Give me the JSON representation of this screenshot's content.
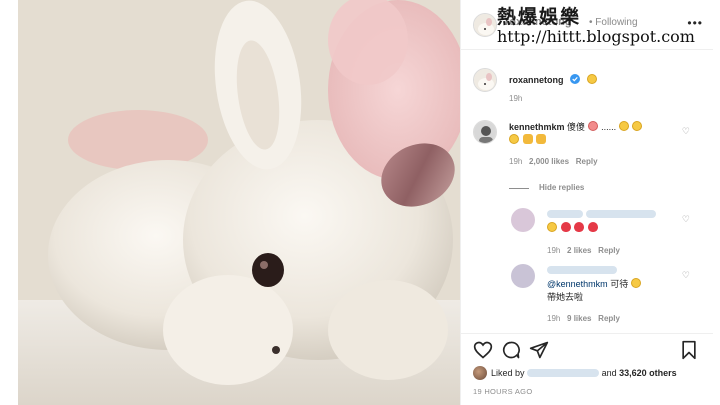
{
  "watermark": {
    "title": "熱爆娛樂",
    "url": "http://hittt.blogspot.com"
  },
  "post_header": {
    "username": "roxannetong",
    "follow_label": "• Following",
    "more_icon": "more-dots-icon"
  },
  "caption": {
    "username": "roxannetong",
    "verified_icon": "verified-badge-icon",
    "emoji_icon": "frowning-face-emoji",
    "age": "19h"
  },
  "comments": [
    {
      "username": "kennethmkm",
      "text": "傻傻",
      "ellipsis": "......",
      "age": "19h",
      "likes": "2,000 likes",
      "reply_label": "Reply",
      "hide_replies_label": "Hide replies"
    }
  ],
  "replies": [
    {
      "username": "kh████ @k████████",
      "age": "19h",
      "likes": "2 likes",
      "reply_label": "Reply"
    },
    {
      "mention": "@kennethmkm",
      "text_line1": "可待",
      "text_line2": "帶她去啦",
      "age": "19h",
      "likes": "9 likes",
      "reply_label": "Reply"
    }
  ],
  "footer": {
    "liked_by_prefix": "Liked by",
    "liked_by_suffix": "and",
    "others": "33,620 others",
    "time_ago": "19 HOURS AGO"
  },
  "colors": {
    "verified": "#3897f0",
    "heart_red": "#e53947",
    "muted_text": "#8e8e8e",
    "divider": "#efefef"
  }
}
